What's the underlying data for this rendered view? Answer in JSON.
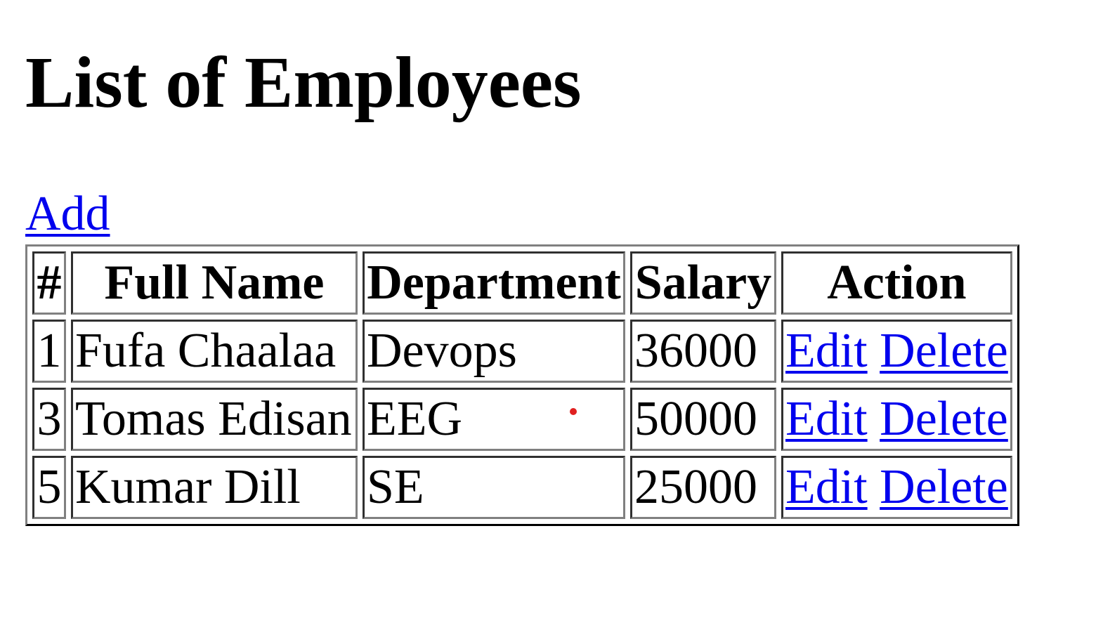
{
  "page": {
    "title": "List of Employees",
    "add_label": "Add"
  },
  "table": {
    "headers": [
      "#",
      "Full Name",
      "Department",
      "Salary",
      "Action"
    ],
    "rows": [
      {
        "id": "1",
        "full_name": "Fufa Chaalaa",
        "department": "Devops",
        "salary": "36000",
        "edit_label": "Edit",
        "delete_label": "Delete"
      },
      {
        "id": "3",
        "full_name": "Tomas Edisan",
        "department": "EEG",
        "salary": "50000",
        "edit_label": "Edit",
        "delete_label": "Delete"
      },
      {
        "id": "5",
        "full_name": "Kumar Dill",
        "department": "SE",
        "salary": "25000",
        "edit_label": "Edit",
        "delete_label": "Delete"
      }
    ]
  },
  "colors": {
    "link": "#0000ee",
    "cursor_dot": "#e02020"
  }
}
